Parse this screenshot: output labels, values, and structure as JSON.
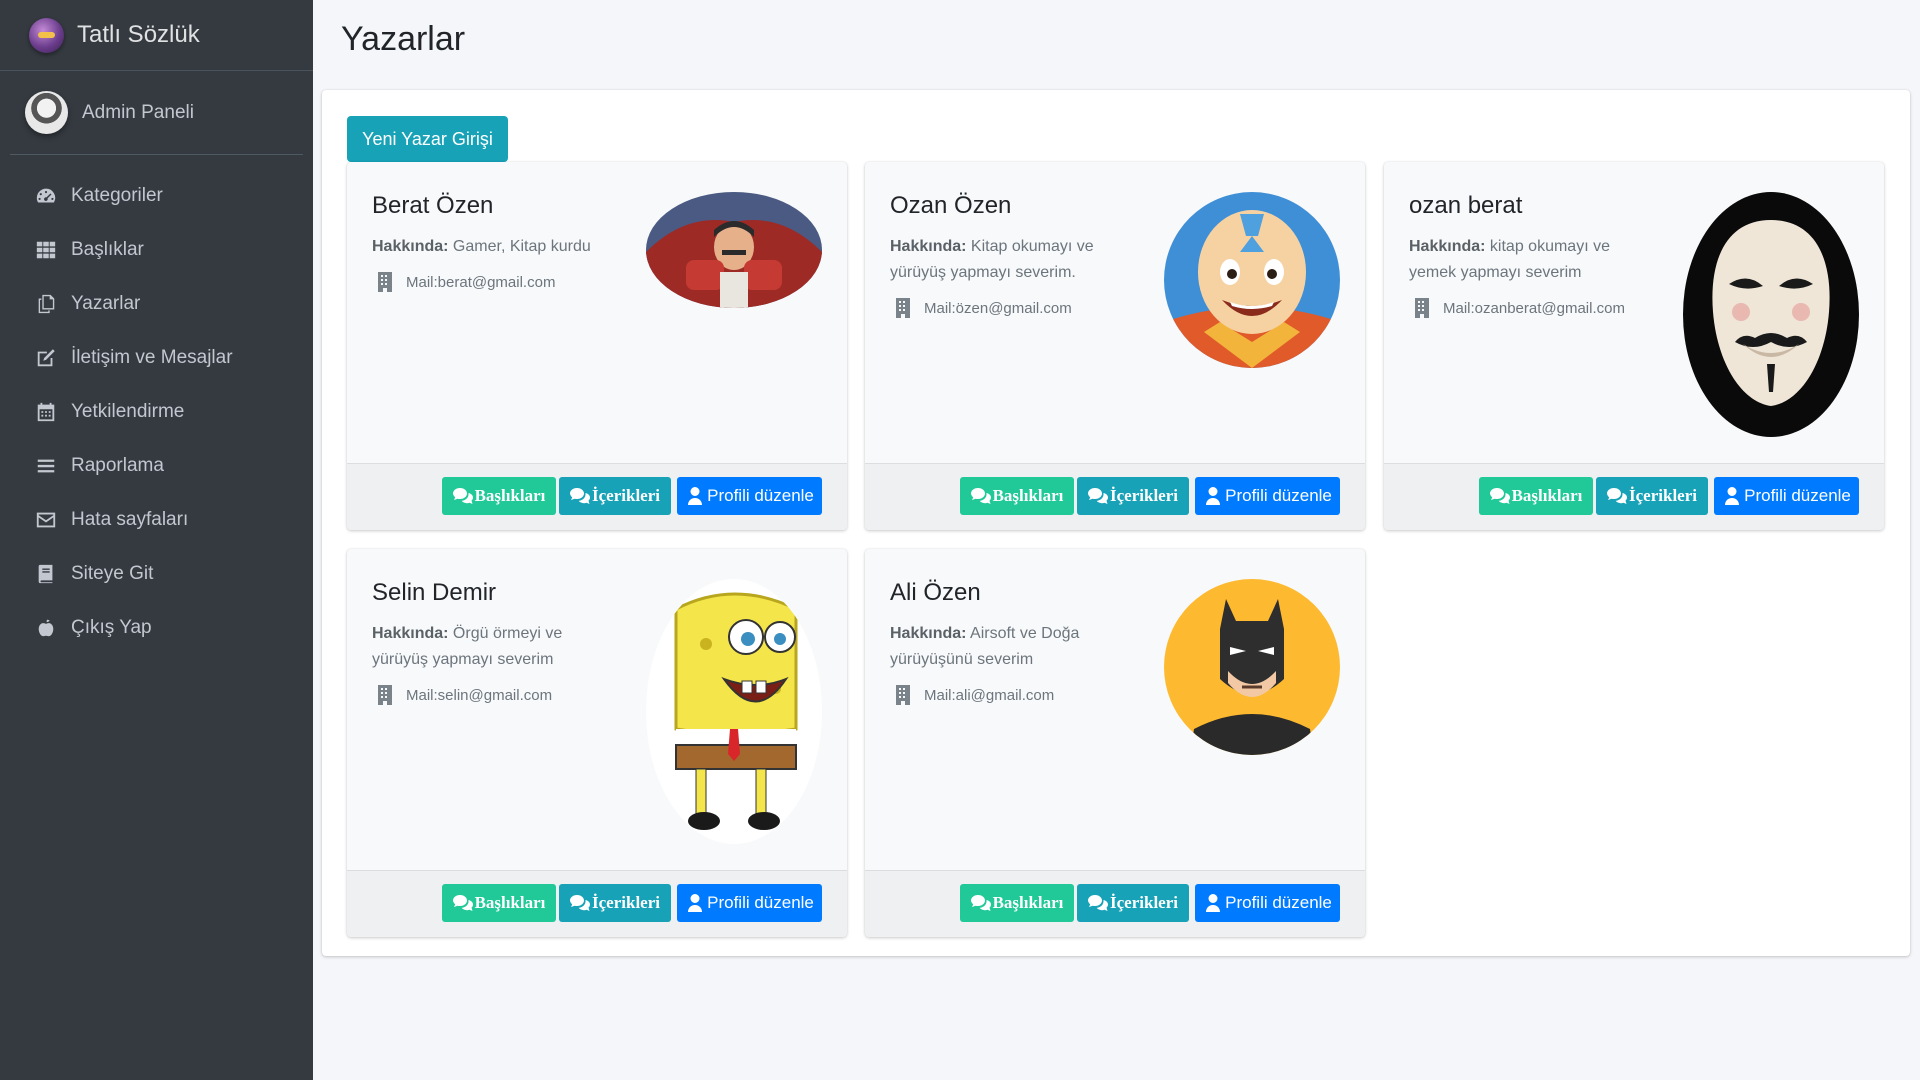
{
  "brand": {
    "name": "Tatlı Sözlük"
  },
  "user": {
    "name": "Admin Paneli"
  },
  "sidebar": {
    "items": [
      {
        "label": "Kategoriler",
        "icon": "tachometer-icon"
      },
      {
        "label": "Başlıklar",
        "icon": "grid-icon"
      },
      {
        "label": "Yazarlar",
        "icon": "copy-icon"
      },
      {
        "label": "İletişim ve Mesajlar",
        "icon": "edit-icon"
      },
      {
        "label": "Yetkilendirme",
        "icon": "calendar-icon"
      },
      {
        "label": "Raporlama",
        "icon": "bars-icon"
      },
      {
        "label": "Hata sayfaları",
        "icon": "envelope-icon"
      },
      {
        "label": "Siteye Git",
        "icon": "book-icon"
      },
      {
        "label": "Çıkış Yap",
        "icon": "apple-icon"
      }
    ]
  },
  "page": {
    "title": "Yazarlar",
    "new_button": "Yeni Yazar Girişi"
  },
  "authors": [
    {
      "name": "Berat Özen",
      "about_label": "Hakkında:",
      "about": "Gamer, Kitap kurdu",
      "mail": "Mail:berat@gmail.com",
      "photo": "red-caped-hero"
    },
    {
      "name": "Ozan Özen",
      "about_label": "Hakkında:",
      "about": "Kitap okumayı ve yürüyüş yapmayı severim.",
      "mail": "Mail:özen@gmail.com",
      "photo": "bald-monk-boy"
    },
    {
      "name": "ozan berat",
      "about_label": "Hakkında:",
      "about": "kitap okumayı ve yemek yapmayı severim",
      "mail": "Mail:ozanberat@gmail.com",
      "photo": "guy-fawkes-mask"
    },
    {
      "name": "Selin Demir",
      "about_label": "Hakkında:",
      "about": "Örgü örmeyi ve yürüyüş yapmayı severim",
      "mail": "Mail:selin@gmail.com",
      "photo": "yellow-sponge"
    },
    {
      "name": "Ali Özen",
      "about_label": "Hakkında:",
      "about": "Airsoft ve Doğa yürüyüşünü severim",
      "mail": "Mail:ali@gmail.com",
      "photo": "bat-hero"
    }
  ],
  "card_buttons": {
    "titles": "Başlıkları",
    "contents": "İçerikleri",
    "edit": "Profili düzenle"
  },
  "colors": {
    "sidebar": "#343a40",
    "green": "#20c997",
    "teal": "#17a2b8",
    "blue": "#007bff"
  }
}
